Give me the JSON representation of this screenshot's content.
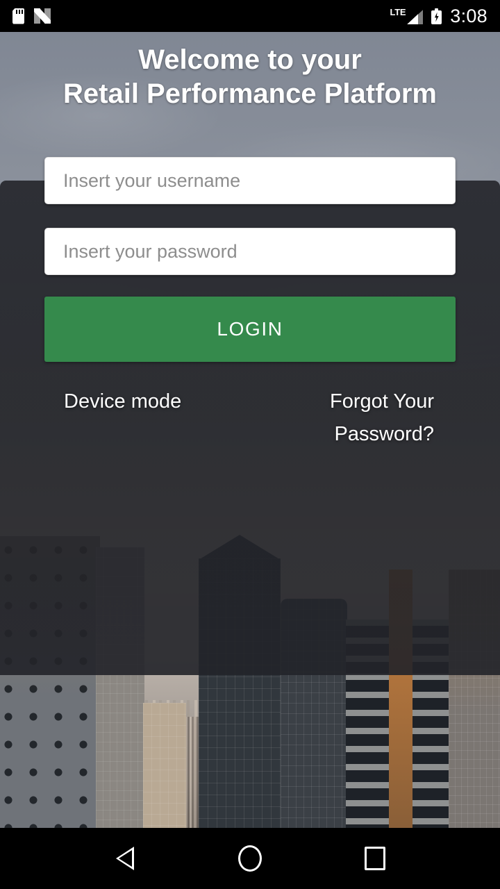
{
  "status_bar": {
    "icons_left": [
      "sd-card-icon",
      "android-n-icon"
    ],
    "network_label": "LTE",
    "icons_right": [
      "signal-icon",
      "battery-charging-icon"
    ],
    "time": "3:08"
  },
  "login": {
    "heading_line1": "Welcome to your",
    "heading_line2": "Retail Performance Platform",
    "username": {
      "value": "",
      "placeholder": "Insert your username"
    },
    "password": {
      "value": "",
      "placeholder": "Insert your password"
    },
    "login_button": "LOGIN",
    "device_mode_link": "Device mode",
    "forgot_password_link": "Forgot Your Password?"
  },
  "nav_bar": {
    "back": "back-icon",
    "home": "home-icon",
    "recents": "recents-icon"
  },
  "colors": {
    "accent_green": "#358a4c",
    "card_overlay": "#222429",
    "text_primary": "#ffffff",
    "placeholder": "#8d8d8d"
  }
}
